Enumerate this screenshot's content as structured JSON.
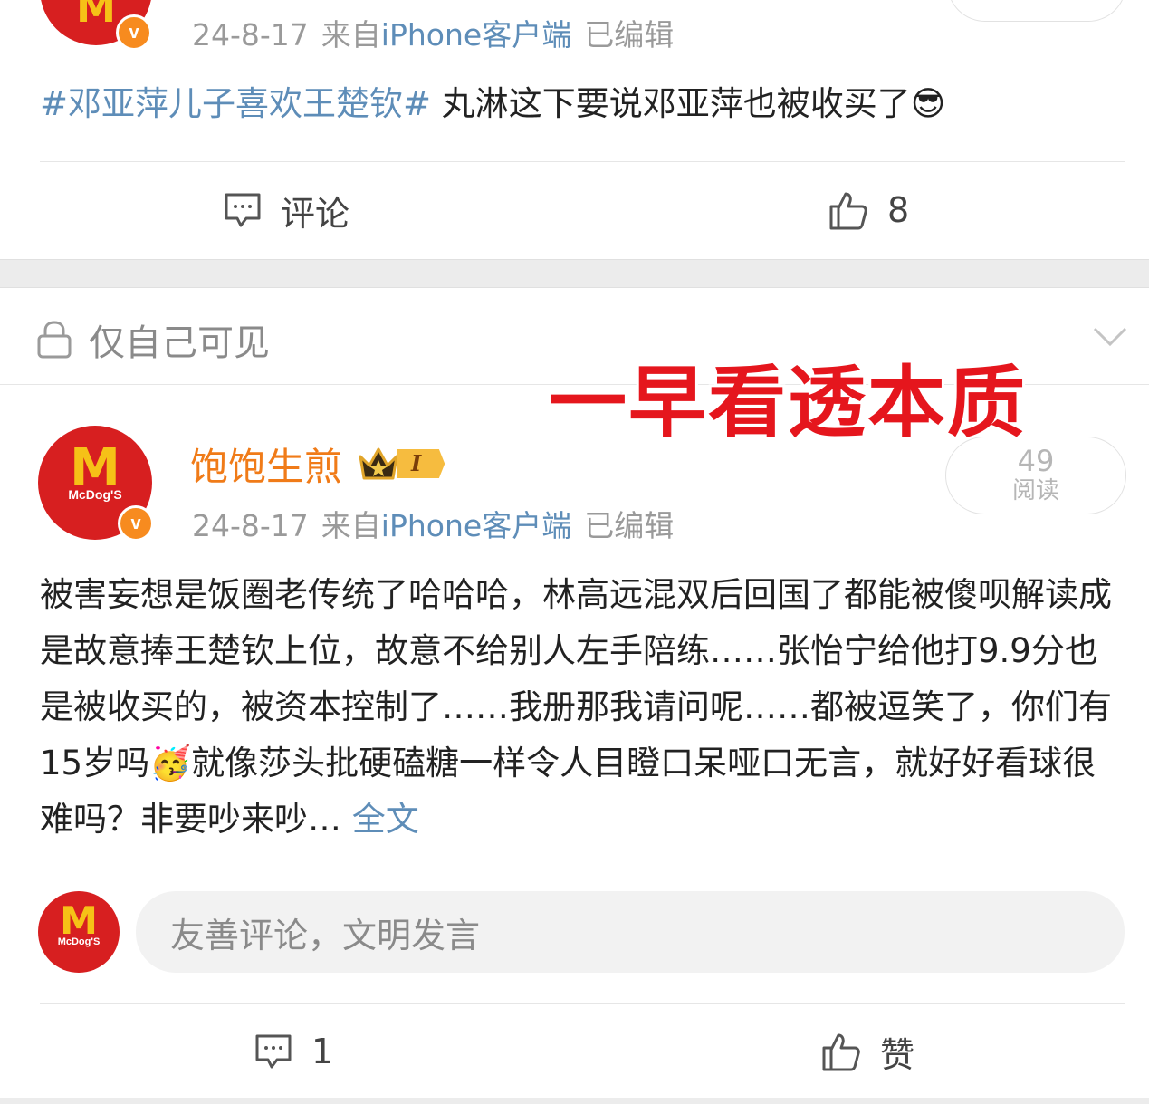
{
  "post1": {
    "date": "24-8-17",
    "source_prefix": "来自",
    "source": "iPhone客户端",
    "edited": "已编辑",
    "topic": "#邓亚萍儿子喜欢王楚钦#",
    "text": " 丸淋这下要说邓亚萍也被收买了",
    "emoji": "😎",
    "comment_label": "评论",
    "like_count": "8"
  },
  "visibility": {
    "label": "仅自己可见"
  },
  "overlay": {
    "title": "一早看透本质"
  },
  "post2": {
    "username": "饱饱生煎",
    "level": "I",
    "date": "24-8-17",
    "source_prefix": "来自",
    "source": "iPhone客户端",
    "edited": "已编辑",
    "read_count": "49",
    "read_label": "阅读",
    "text_part1": "被害妄想是饭圈老传统了哈哈哈，林高远混双后回国了都能被傻呗解读成是故意捧王楚钦上位，故意不给别人左手陪练……张怡宁给他打9.9分也是被收买的，被资本控制了……我册那我请问呢……都被逗笑了，你们有15岁吗",
    "emoji": "🥳",
    "text_part2": "就像莎头批硬磕糖一样令人目瞪口呆哑口无言，就好好看球很难吗？非要吵来吵…",
    "full_text_link": "全文",
    "comment_placeholder": "友善评论，文明发言",
    "comment_count": "1",
    "like_label": "赞"
  },
  "avatar": {
    "brand": "McDog'S"
  },
  "colors": {
    "accent_link": "#5e8db8",
    "username": "#f07b18",
    "overlay_red": "#e5161d",
    "avatar_red": "#d71f20",
    "badge_orange": "#f78b1f"
  },
  "icons": [
    "comment-icon",
    "thumbs-up-icon",
    "lock-icon",
    "chevron-down-icon",
    "verified-badge-icon",
    "crown-icon"
  ]
}
